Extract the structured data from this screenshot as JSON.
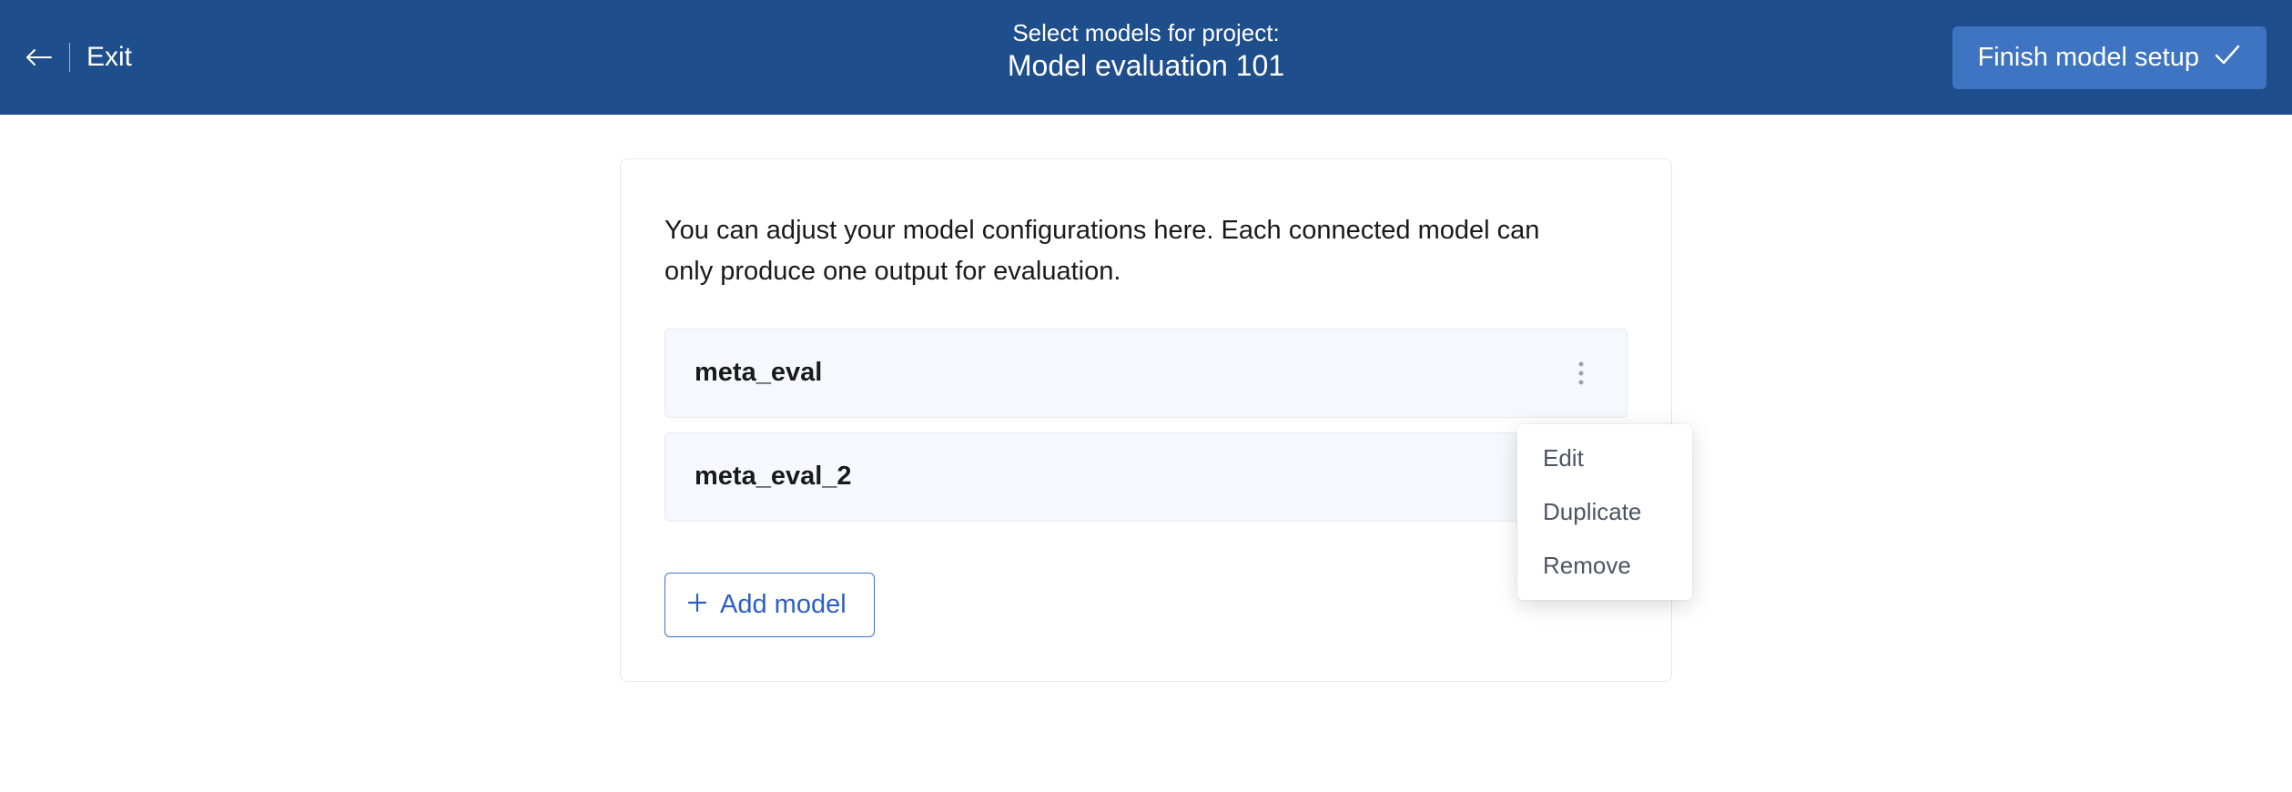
{
  "header": {
    "exit_label": "Exit",
    "subtitle": "Select models for project:",
    "title": "Model evaluation 101",
    "finish_label": "Finish model setup"
  },
  "panel": {
    "description": "You can adjust your model configurations here. Each connected model can only produce one output for evaluation."
  },
  "models": [
    {
      "name": "meta_eval"
    },
    {
      "name": "meta_eval_2"
    }
  ],
  "dropdown": {
    "items": [
      "Edit",
      "Duplicate",
      "Remove"
    ]
  },
  "add_model_label": "Add model"
}
